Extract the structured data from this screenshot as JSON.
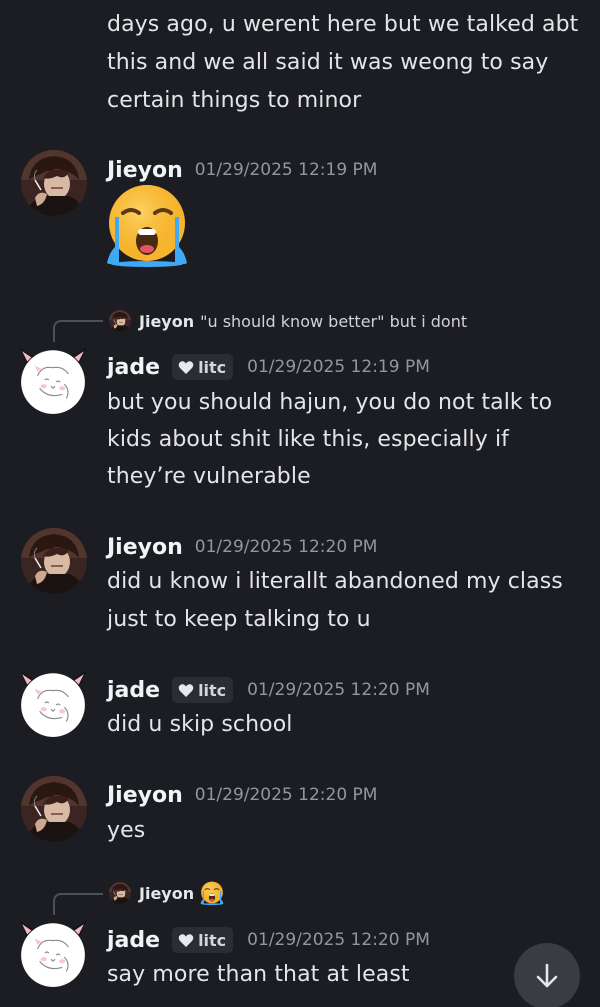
{
  "messages": {
    "top_continuation": {
      "lines": [
        "days ago, u werent here but we talked abt",
        "this and we all said it was weong to say",
        "certain things to minor"
      ]
    },
    "m1": {
      "author": "Jieyon",
      "timestamp": "01/29/2025 12:19 PM",
      "emoji": "loudly-crying-face"
    },
    "m2": {
      "reply_author": "Jieyon",
      "reply_text": "\"u should know better\" but i dont",
      "author": "jade",
      "tag": "litc",
      "timestamp": "01/29/2025 12:19 PM",
      "lines": [
        "but you should hajun, you do not talk to",
        "kids about shit like this, especially if",
        "they’re vulnerable"
      ]
    },
    "m3": {
      "author": "Jieyon",
      "timestamp": "01/29/2025 12:20 PM",
      "lines": [
        "did u know i literallt abandoned my class",
        "just to keep talking to u"
      ]
    },
    "m4": {
      "author": "jade",
      "tag": "litc",
      "timestamp": "01/29/2025 12:20 PM",
      "lines": [
        "did u skip school"
      ]
    },
    "m5": {
      "author": "Jieyon",
      "timestamp": "01/29/2025 12:20 PM",
      "lines": [
        "yes"
      ]
    },
    "m6": {
      "reply_author": "Jieyon",
      "reply_emoji": "loudly-crying-face",
      "author": "jade",
      "tag": "litc",
      "timestamp": "01/29/2025 12:20 PM",
      "lines": [
        "say more than that at least"
      ]
    }
  },
  "scroll_button": {
    "icon": "arrow-down-icon"
  },
  "colors": {
    "background": "#1c1d23",
    "text": "#e4e5e8",
    "timestamp": "#94969e",
    "tag_bg": "#2c2d34"
  }
}
